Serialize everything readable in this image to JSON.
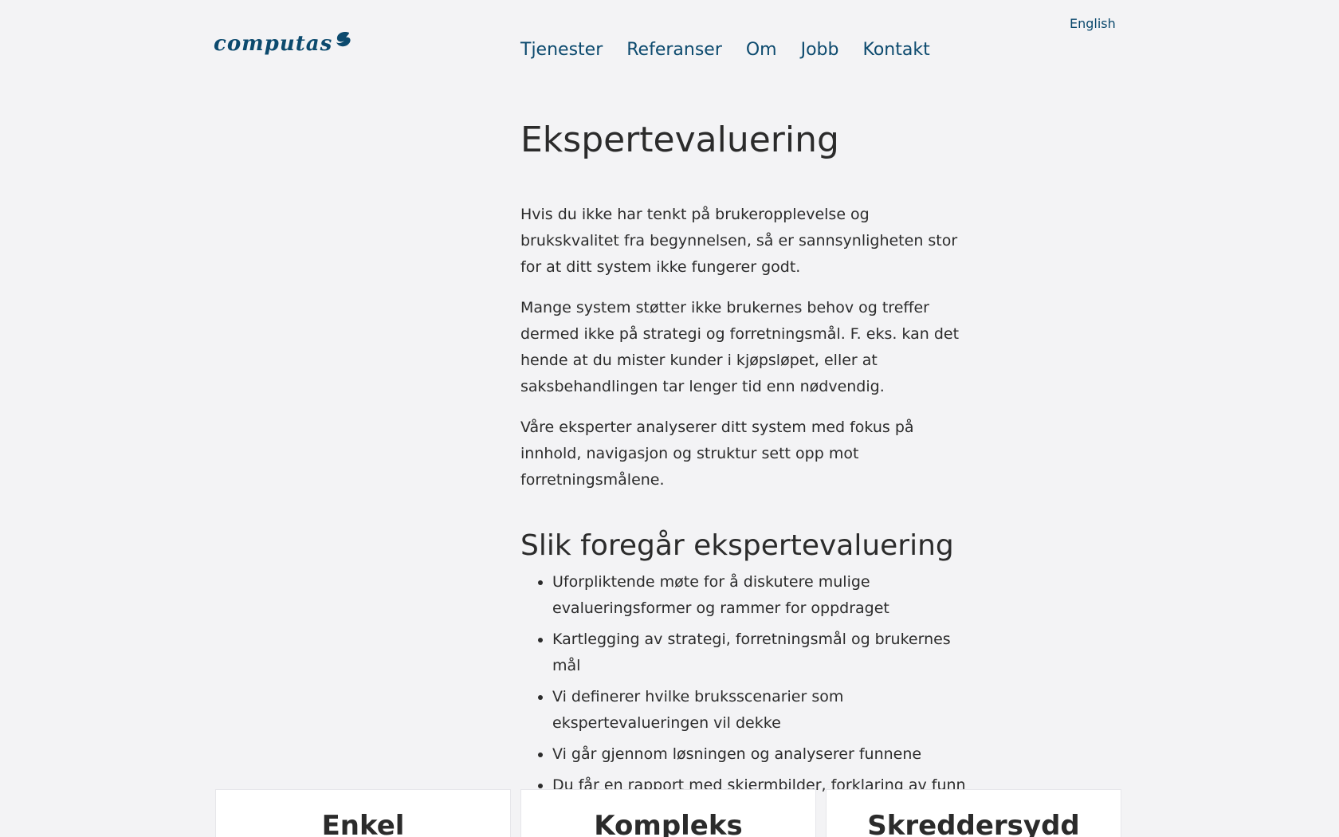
{
  "header": {
    "logo_text": "computas",
    "language_link": "English",
    "nav": [
      {
        "label": "Tjenester"
      },
      {
        "label": "Referanser"
      },
      {
        "label": "Om"
      },
      {
        "label": "Jobb"
      },
      {
        "label": "Kontakt"
      }
    ]
  },
  "main": {
    "title": "Ekspertevaluering",
    "paragraphs": [
      "Hvis du ikke har tenkt på brukeropplevelse og brukskvalitet fra begynnelsen, så er sannsynligheten stor for at ditt system ikke fungerer godt.",
      "Mange system støtter ikke brukernes behov og treffer dermed ikke på strategi og forretningsmål. F. eks. kan det hende at du mister kunder i kjøpsløpet, eller at saksbehandlingen tar lenger tid enn nødvendig.",
      "Våre eksperter analyserer ditt system med fokus på innhold, navigasjon og struktur sett opp mot forretningsmålene."
    ],
    "subheading": "Slik foregår ekspertevaluering",
    "steps": [
      "Uforpliktende møte for å diskutere mulige evalueringsformer og rammer for oppdraget",
      "Kartlegging av strategi, forretningsmål og brukernes mål",
      "Vi definerer hvilke bruksscenarier som ekspertevalueringen vil dekke",
      "Vi går gjennom løsningen og analyserer funnene",
      "Du får en rapport med skjermbilder, forklaring av funn og løsningsforslag"
    ]
  },
  "cards": [
    {
      "title": "Enkel"
    },
    {
      "title": "Kompleks"
    },
    {
      "title": "Skreddersydd"
    }
  ],
  "colors": {
    "brand": "#0c4a6e",
    "background": "#f3f3f5",
    "text": "#2b2b2b",
    "card_background": "#ffffff"
  }
}
